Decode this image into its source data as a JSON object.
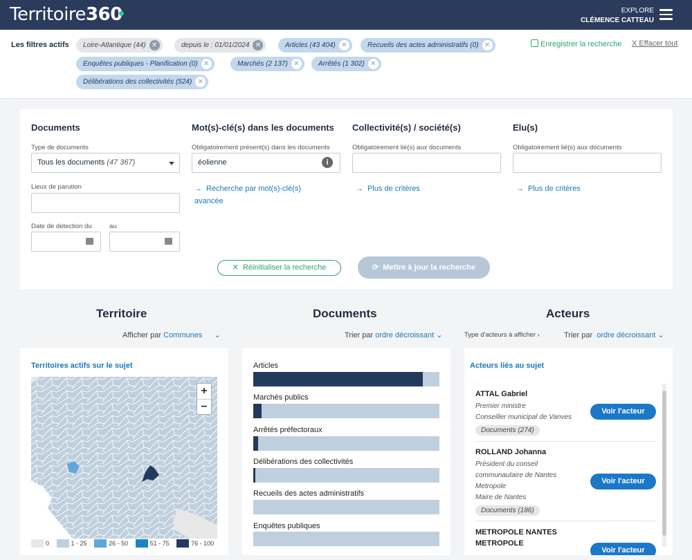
{
  "header": {
    "logo_text": "Territoire",
    "logo_num": "360",
    "explore_label": "EXPLORE",
    "user_name": "CLÉMENCE CATTEAU"
  },
  "filters": {
    "label": "Les filtres actifs",
    "chips": [
      {
        "label": "Loire-Atlantique (44)",
        "style": "grey"
      },
      {
        "label": "depuis le : 01/01/2024",
        "style": "grey"
      },
      {
        "label": "Articles (43 404)",
        "style": "blue"
      },
      {
        "label": "Recueils des actes administratifs (0)",
        "style": "blue"
      },
      {
        "label": "Enquêtes publiques - Planification (0)",
        "style": "blue"
      },
      {
        "label": "Marchés (2 137)",
        "style": "blue"
      },
      {
        "label": "Arrêtés (1 302)",
        "style": "blue"
      },
      {
        "label": "Délibérations des collectivités (524)",
        "style": "blue"
      }
    ],
    "save_label": "Enregistrer la recherche",
    "clear_label": "X Effacer tout"
  },
  "search": {
    "documents": {
      "title": "Documents",
      "type_label": "Type de documents",
      "type_value": "Tous les documents",
      "type_count": "(47 367)",
      "places_label": "Lieux de parution",
      "date_from_label": "Date de detection du",
      "date_to_label": "au"
    },
    "keywords": {
      "title": "Mot(s)-clé(s) dans les documents",
      "field_label": "Obligatoirement présent(s) dans les documents",
      "value": "éolienne",
      "advanced_link_1": "Recherche par mot(s)-clé(s)",
      "advanced_link_2": "avancée"
    },
    "collectivities": {
      "title": "Collectivité(s) / société(s)",
      "field_label": "Obligatoirement lié(s) aux documents",
      "more_link": "Plus de critères"
    },
    "elected": {
      "title": "Elu(s)",
      "field_label": "Obligatoirement lié(s) aux documents",
      "more_link": "Plus de critères"
    },
    "reset_label": "Réinitialiser la recherche",
    "update_label": "Mettre à jour la recherche"
  },
  "territoire": {
    "title": "Territoire",
    "display_prefix": "Afficher par",
    "display_value": "Communes",
    "card_title": "Territoires actifs sur le sujet",
    "legend": [
      {
        "label": "0",
        "color": "#e8e8e8"
      },
      {
        "label": "1 - 25",
        "color": "#bfcfdd"
      },
      {
        "label": "26 - 50",
        "color": "#5fa7d9"
      },
      {
        "label": "51 - 75",
        "color": "#1b84c9"
      },
      {
        "label": "76 - 100",
        "color": "#233a5e"
      }
    ]
  },
  "documents_section": {
    "title": "Documents",
    "sort_prefix": "Trier par",
    "sort_value": "ordre décroissant",
    "bars": [
      {
        "label": "Articles",
        "value": 0.91
      },
      {
        "label": "Marchés publics",
        "value": 0.045
      },
      {
        "label": "Arrêtés préfectoraux",
        "value": 0.027
      },
      {
        "label": "Délibérations des collectivités",
        "value": 0.011
      },
      {
        "label": "Recueils des actes administratifs",
        "value": 0
      },
      {
        "label": "Enquêtes publiques",
        "value": 0
      }
    ]
  },
  "acteurs": {
    "title": "Acteurs",
    "type_label": "Type d'acteurs à afficher",
    "sort_prefix": "Trier par",
    "sort_value": "ordre décroissant",
    "card_title": "Acteurs liés au sujet",
    "button_label": "Voir l'acteur",
    "list": [
      {
        "name": "ATTAL Gabriel",
        "roles": [
          "Premier ministre",
          "Conseiller municipal de Vanves"
        ],
        "docs": "Documents (274)"
      },
      {
        "name": "ROLLAND Johanna",
        "roles": [
          "Président du conseil",
          "communautaire de Nantes",
          "Metropole",
          "Maire de Nantes"
        ],
        "docs": "Documents (186)"
      },
      {
        "name": "METROPOLE NANTES",
        "name2": "METROPOLE",
        "roles": [],
        "docs": ""
      }
    ]
  }
}
